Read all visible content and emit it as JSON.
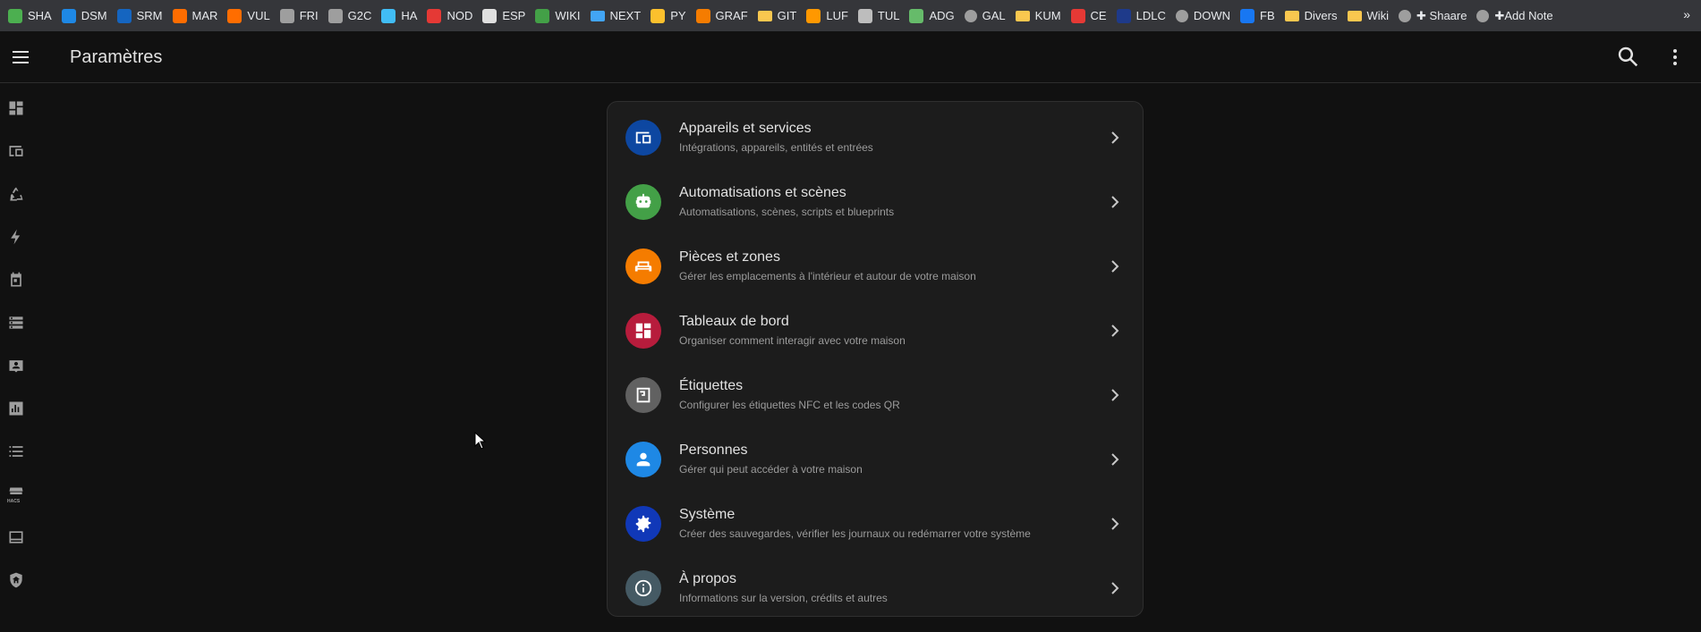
{
  "bookmarks": [
    {
      "label": "SHA",
      "icon": "leaf-icon",
      "color": "#4caf50"
    },
    {
      "label": "DSM",
      "icon": "dsm-icon",
      "color": "#1e88e5"
    },
    {
      "label": "SRM",
      "icon": "srm-icon",
      "color": "#1565c0"
    },
    {
      "label": "MAR",
      "icon": "x-orange-icon",
      "color": "#ff6d00"
    },
    {
      "label": "VUL",
      "icon": "x-orange-icon",
      "color": "#ff6d00"
    },
    {
      "label": "FRI",
      "icon": "dash-icon",
      "color": "#9e9e9e"
    },
    {
      "label": "G2C",
      "icon": "terminal-icon",
      "color": "#9e9e9e"
    },
    {
      "label": "HA",
      "icon": "home-assistant-icon",
      "color": "#41bdf5"
    },
    {
      "label": "NOD",
      "icon": "node-red-icon",
      "color": "#e53935"
    },
    {
      "label": "ESP",
      "icon": "esp-icon",
      "color": "#e0e0e0"
    },
    {
      "label": "WIKI",
      "icon": "wiki-icon",
      "color": "#43a047"
    },
    {
      "label": "NEXT",
      "icon": "folder-blue-icon",
      "color": "#42a5f5"
    },
    {
      "label": "PY",
      "icon": "python-icon",
      "color": "#fbc02d"
    },
    {
      "label": "GRAF",
      "icon": "grafana-icon",
      "color": "#f57c00"
    },
    {
      "label": "GIT",
      "icon": "folder-icon",
      "color": "#f9c74f"
    },
    {
      "label": "LUF",
      "icon": "lightning-icon",
      "color": "#ff9800"
    },
    {
      "label": "TUL",
      "icon": "tul-icon",
      "color": "#bdbdbd"
    },
    {
      "label": "ADG",
      "icon": "shield-green-icon",
      "color": "#66bb6a"
    },
    {
      "label": "GAL",
      "icon": "globe-icon",
      "color": "#9e9e9e"
    },
    {
      "label": "KUM",
      "icon": "folder-icon",
      "color": "#f9c74f"
    },
    {
      "label": "CE",
      "icon": "ce-icon",
      "color": "#e53935"
    },
    {
      "label": "LDLC",
      "icon": "ldlc-icon",
      "color": "#1e3a8a"
    },
    {
      "label": "DOWN",
      "icon": "globe-icon",
      "color": "#9e9e9e"
    },
    {
      "label": "FB",
      "icon": "facebook-icon",
      "color": "#1877f2"
    },
    {
      "label": "Divers",
      "icon": "folder-icon",
      "color": "#f9c74f"
    },
    {
      "label": "Wiki",
      "icon": "folder-icon",
      "color": "#f9c74f"
    },
    {
      "label": "✚ Shaare",
      "icon": "globe-icon",
      "color": "#9e9e9e"
    },
    {
      "label": "✚Add Note",
      "icon": "globe-icon",
      "color": "#9e9e9e"
    }
  ],
  "overflow_label": "»",
  "header": {
    "title": "Paramètres"
  },
  "sidebar": [
    "dashboard-icon",
    "devices-icon",
    "recycle-icon",
    "energy-icon",
    "calendar-icon",
    "server-icon",
    "badge-account-icon",
    "chart-icon",
    "list-icon",
    "hacs-icon",
    "media-icon",
    "shield-home-icon"
  ],
  "hacs_label": "HACS",
  "settings": [
    {
      "title": "Appareils et services",
      "subtitle": "Intégrations, appareils, entités et entrées",
      "icon": "devices-icon",
      "color": "#0d47a1"
    },
    {
      "title": "Automatisations et scènes",
      "subtitle": "Automatisations, scènes, scripts et blueprints",
      "icon": "robot-icon",
      "color": "#43a047"
    },
    {
      "title": "Pièces et zones",
      "subtitle": "Gérer les emplacements à l'intérieur et autour de votre maison",
      "icon": "sofa-icon",
      "color": "#f57c00"
    },
    {
      "title": "Tableaux de bord",
      "subtitle": "Organiser comment interagir avec votre maison",
      "icon": "dashboard-icon",
      "color": "#b71c3c"
    },
    {
      "title": "Étiquettes",
      "subtitle": "Configurer les étiquettes NFC et les codes QR",
      "icon": "nfc-icon",
      "color": "#616161"
    },
    {
      "title": "Personnes",
      "subtitle": "Gérer qui peut accéder à votre maison",
      "icon": "account-icon",
      "color": "#1e88e5"
    },
    {
      "title": "Système",
      "subtitle": "Créer des sauvegardes, vérifier les journaux ou redémarrer votre système",
      "icon": "cog-icon",
      "color": "#1038b8"
    },
    {
      "title": "À propos",
      "subtitle": "Informations sur la version, crédits et autres",
      "icon": "info-icon",
      "color": "#455a64"
    }
  ]
}
